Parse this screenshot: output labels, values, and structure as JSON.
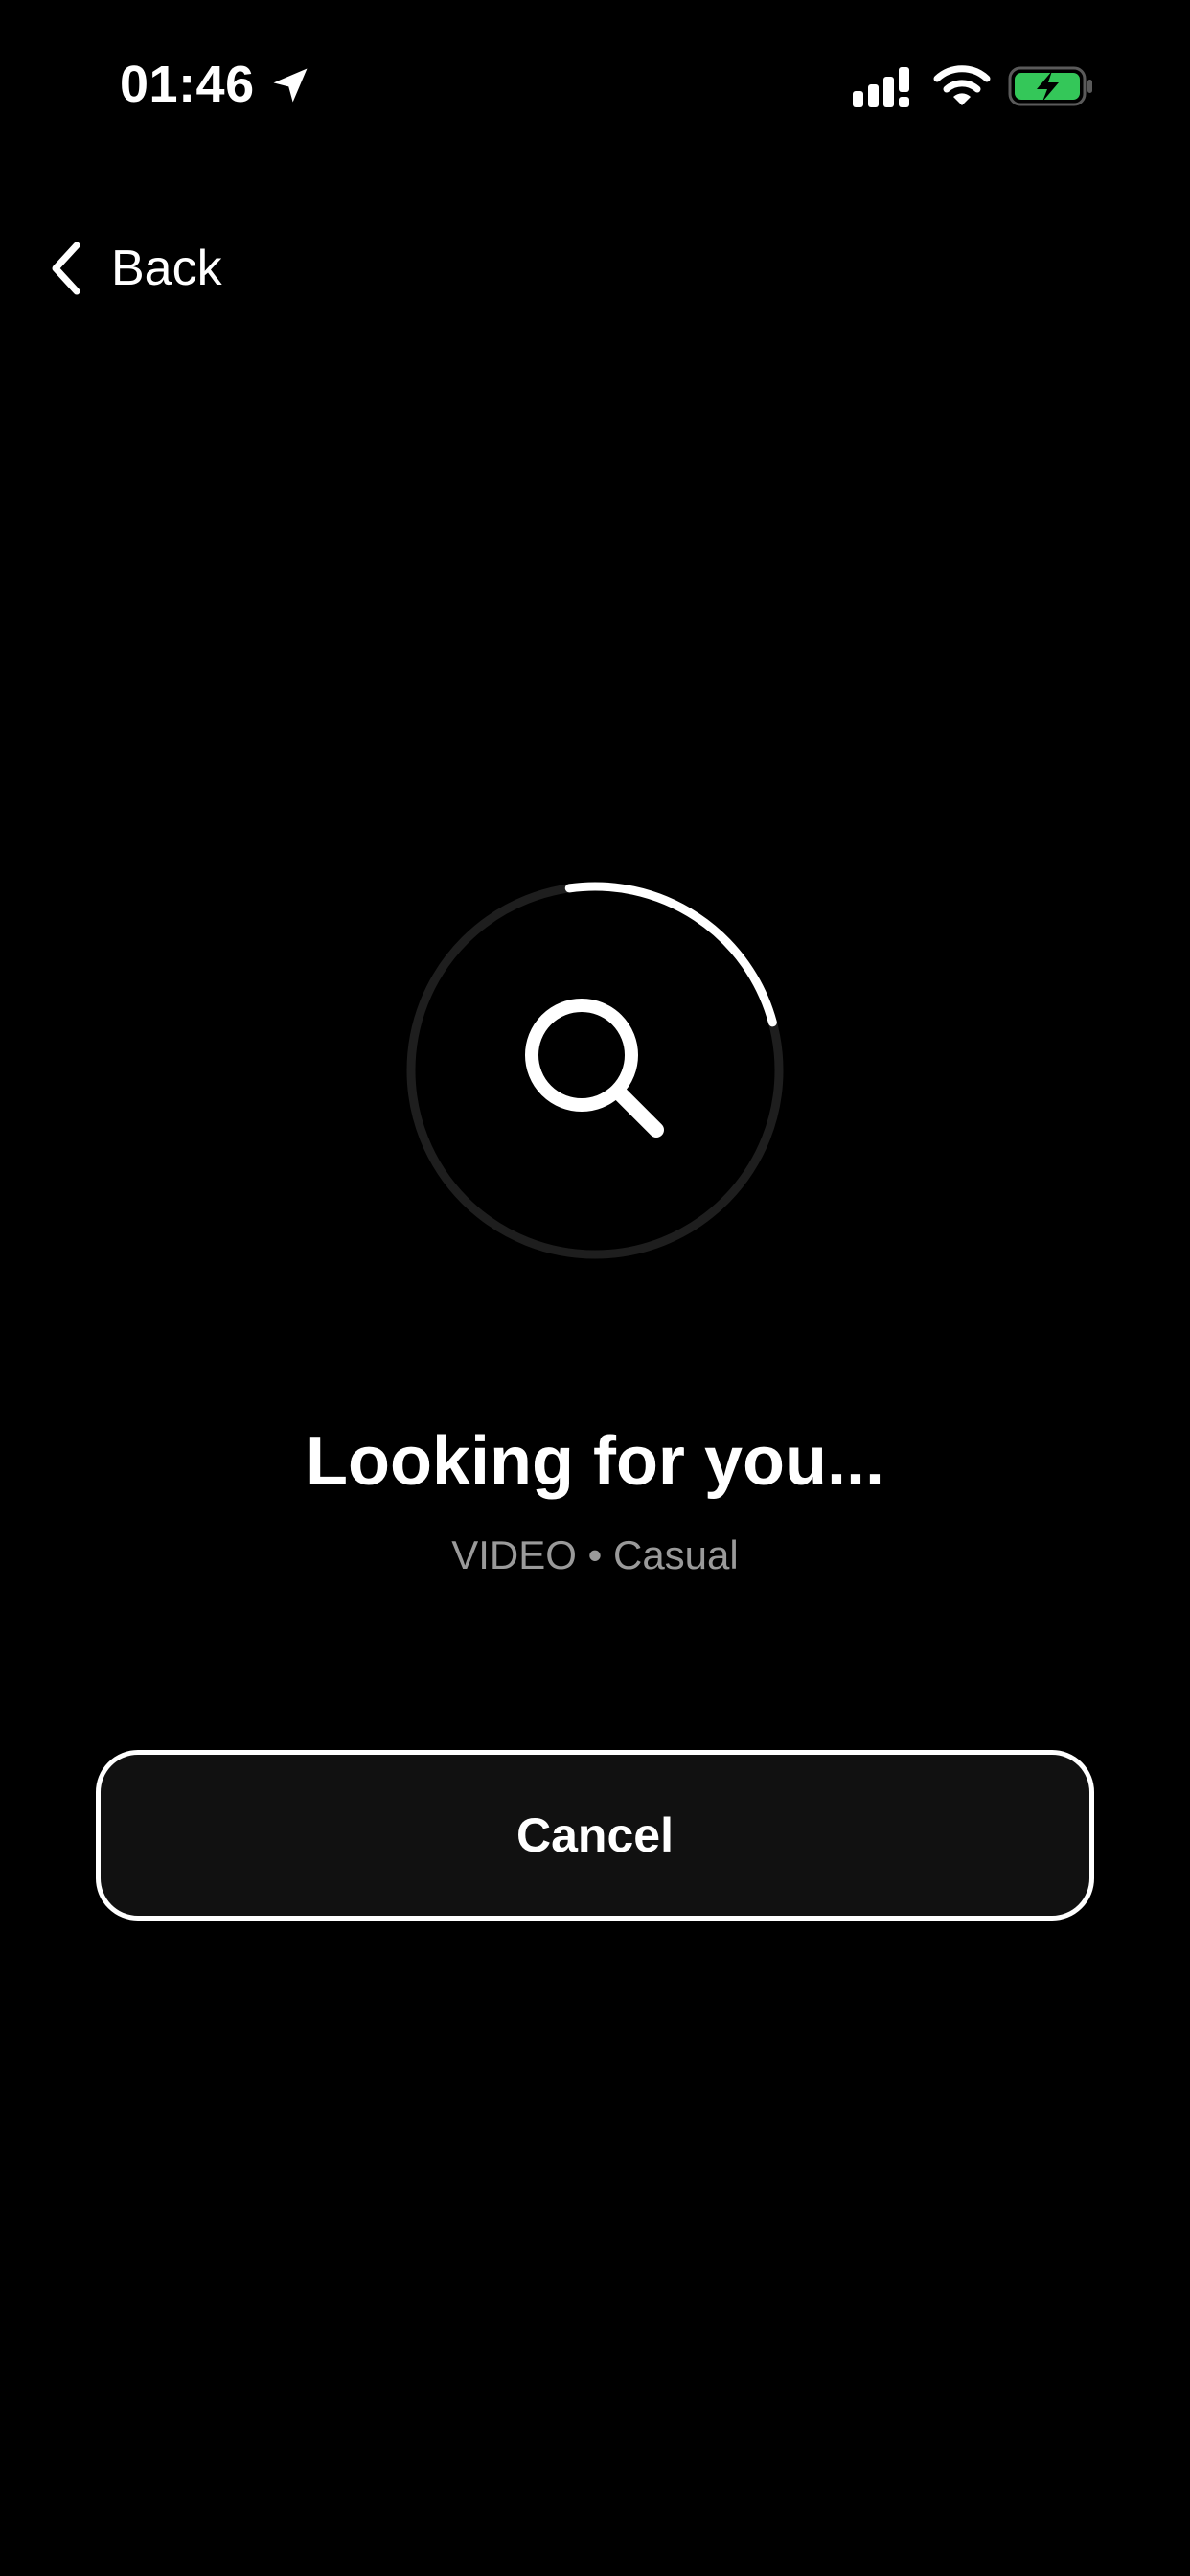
{
  "status_bar": {
    "time": "01:46",
    "icons": [
      "location-arrow-icon",
      "cellular-signal-icon",
      "wifi-icon",
      "battery-charging-icon"
    ],
    "battery_color": "#34C759"
  },
  "nav": {
    "back_label": "Back"
  },
  "search": {
    "icon": "search-icon",
    "spinner_progress": 0.23,
    "heading": "Looking for you...",
    "subheading": "VIDEO • Casual"
  },
  "actions": {
    "cancel_label": "Cancel"
  },
  "colors": {
    "background": "#000000",
    "text": "#FFFFFF",
    "muted_text": "#9A9A9A",
    "ring_track": "#1E1E1E",
    "button_fill": "#111111"
  }
}
